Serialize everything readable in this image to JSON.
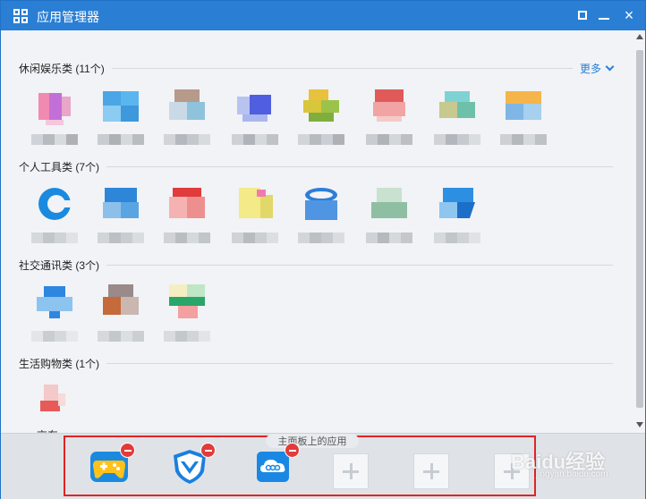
{
  "window": {
    "title": "应用管理器"
  },
  "sections": [
    {
      "label": "休闲娱乐类 (11个)",
      "more": "更多"
    },
    {
      "label": "个人工具类 (7个)"
    },
    {
      "label": "社交通讯类 (3个)"
    },
    {
      "label": "生活购物类 (1个)"
    }
  ],
  "apps": {
    "leisure": [
      "",
      "",
      "",
      "",
      "",
      "",
      "",
      ""
    ],
    "tools": [
      "",
      "",
      "",
      "",
      "",
      "",
      ""
    ],
    "social": [
      "",
      "",
      ""
    ],
    "shopping": [
      "京东"
    ]
  },
  "dock": {
    "label": "主面板上的应用",
    "apps": [
      {
        "icon": "game-icon"
      },
      {
        "icon": "tencent-security-icon"
      },
      {
        "icon": "weiyun-icon"
      }
    ],
    "empty_slots": 3
  },
  "watermark": {
    "text": "Baidu经验",
    "sub": "jingyan.baidu.com"
  },
  "colors": {
    "titlebar": "#2a7fd4",
    "accent": "#2a7fd4",
    "highlight": "#e02424",
    "remove": "#e23b3b"
  }
}
